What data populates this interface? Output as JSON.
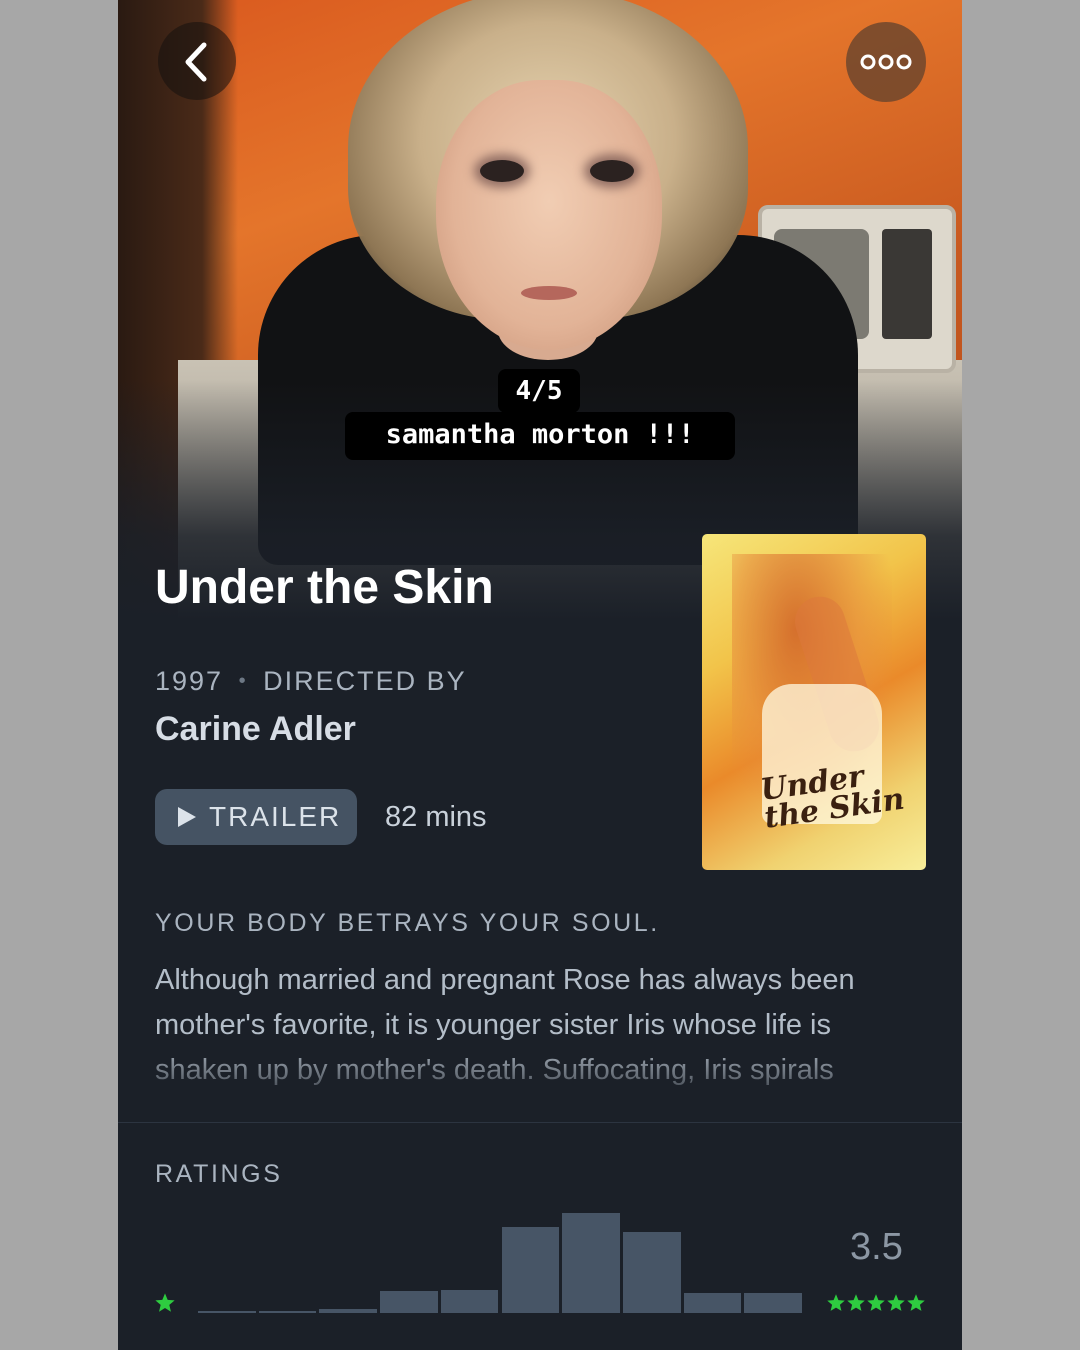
{
  "nav": {
    "back_icon": "chevron-left-icon",
    "more_icon": "ellipsis-icon"
  },
  "story_overlay": {
    "count": "4/5",
    "caption": "samantha morton !!!"
  },
  "film": {
    "title": "Under the Skin",
    "year": "1997",
    "separator": "•",
    "directed_by_label": "DIRECTED BY",
    "director": "Carine Adler",
    "trailer_label": "TRAILER",
    "runtime": "82 mins",
    "poster_title": "Under the Skin",
    "tagline": "YOUR BODY BETRAYS YOUR SOUL.",
    "synopsis": "Although married and pregnant Rose has always been mother's favorite, it is younger sister Iris whose life is shaken up by mother's death. Suffocating, Iris spirals"
  },
  "ratings": {
    "label": "RATINGS",
    "average": "3.5",
    "star_color": "#2ecc40",
    "histogram": [
      0.5,
      1,
      1.5,
      2,
      2.5,
      3,
      3.5,
      4,
      4.5,
      5
    ],
    "histogram_relative_heights": [
      0.02,
      0.02,
      0.04,
      0.22,
      0.23,
      0.86,
      1.0,
      0.81,
      0.2,
      0.2
    ]
  }
}
